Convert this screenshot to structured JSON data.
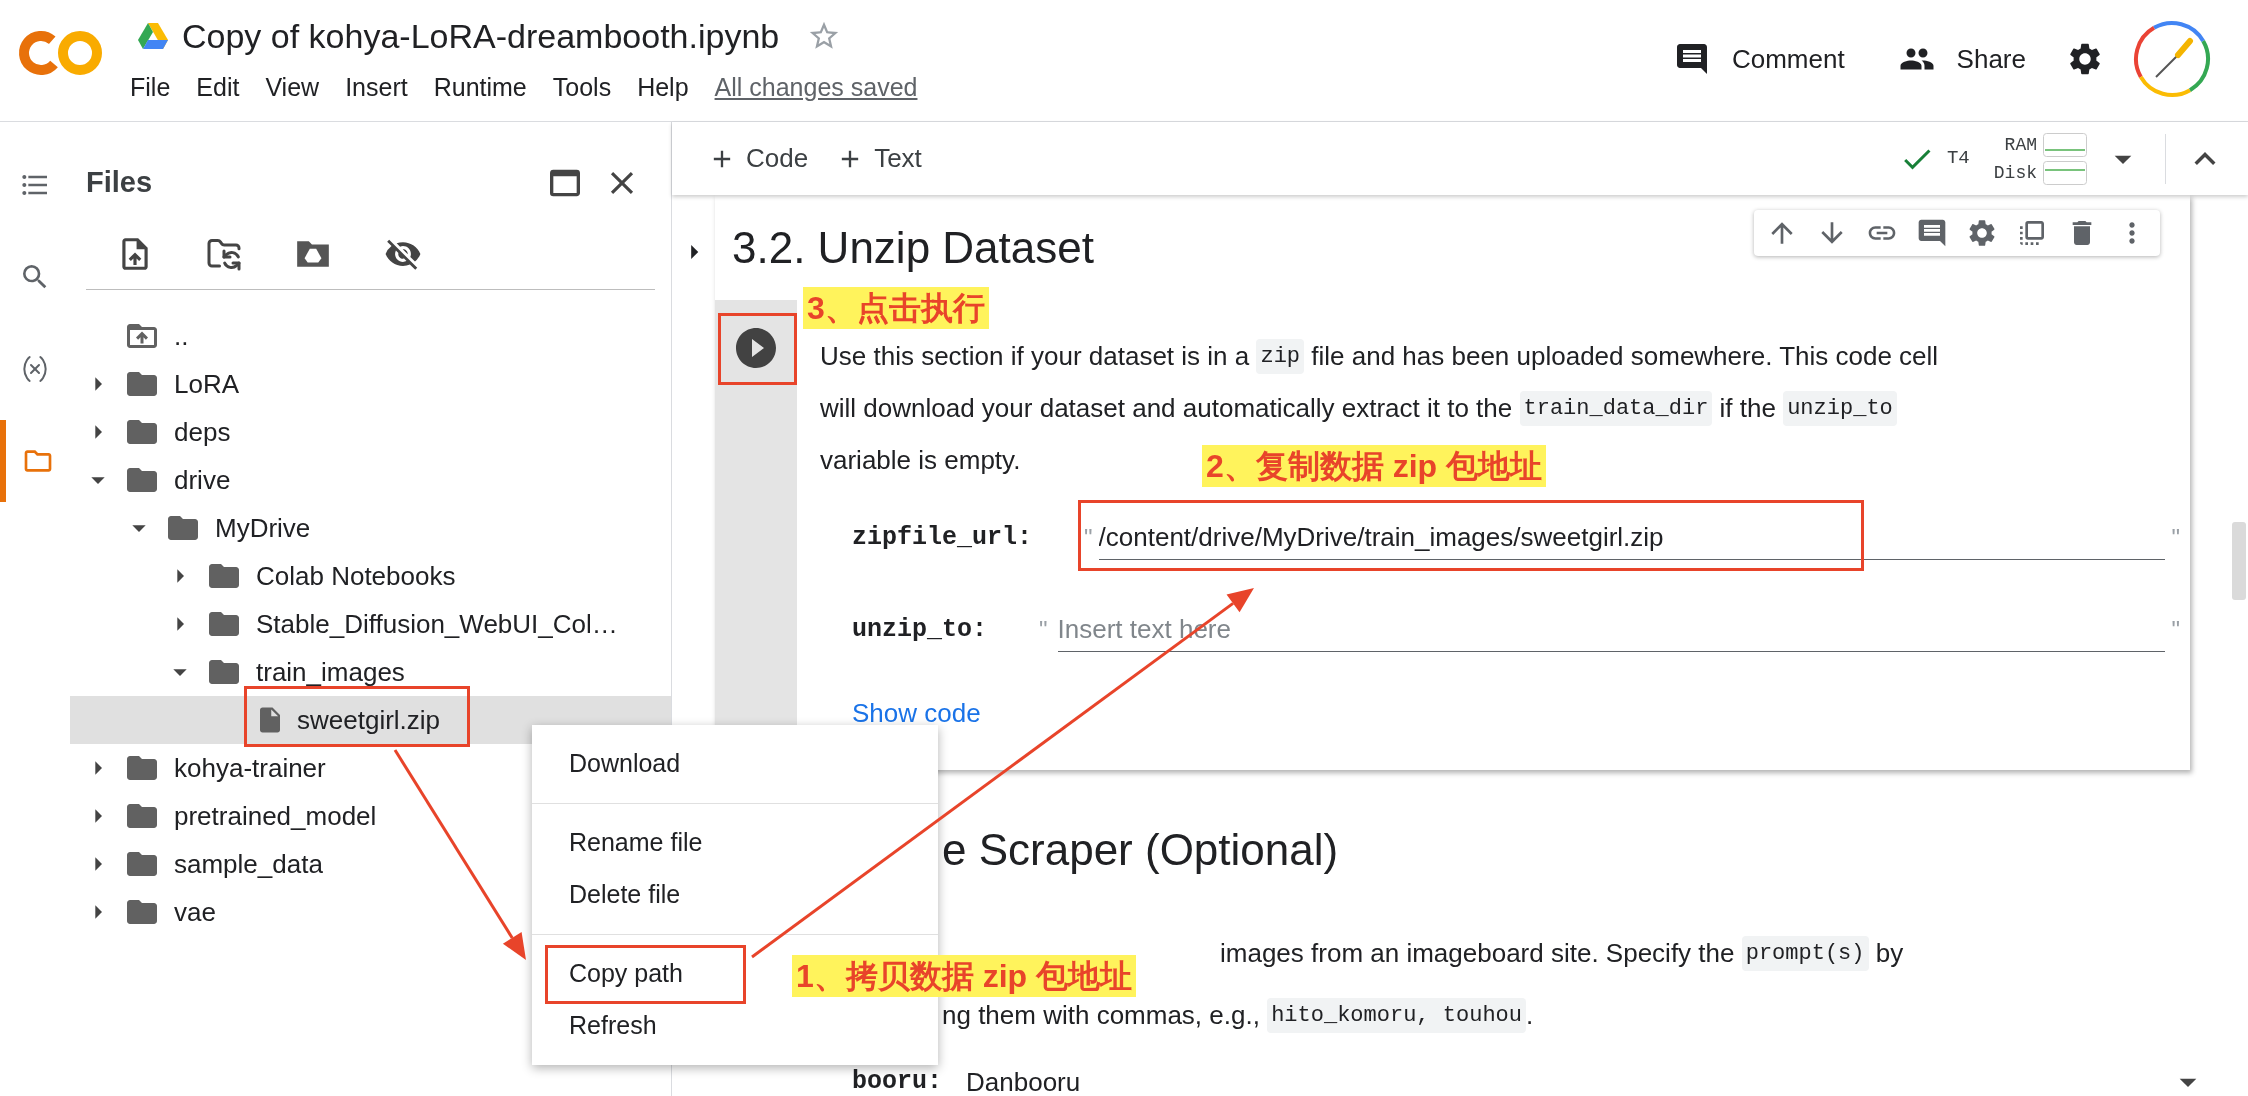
{
  "header": {
    "title": "Copy of kohya-LoRA-dreambooth.ipynb",
    "starred": false,
    "menu": [
      "File",
      "Edit",
      "View",
      "Insert",
      "Runtime",
      "Tools",
      "Help"
    ],
    "save_status": "All changes saved",
    "actions": [
      {
        "kind": "comment",
        "label": "Comment"
      },
      {
        "kind": "share",
        "label": "Share"
      }
    ]
  },
  "rail": [
    {
      "kind": "toc",
      "selected": false
    },
    {
      "kind": "search",
      "selected": false
    },
    {
      "kind": "variables",
      "selected": false
    },
    {
      "kind": "files",
      "selected": true
    }
  ],
  "files_panel": {
    "title": "Files",
    "tree": [
      {
        "name": "..",
        "kind": "parent",
        "selected": false
      },
      {
        "name": "LoRA",
        "kind": "folder",
        "expanded": false,
        "selected": false
      },
      {
        "name": "deps",
        "kind": "folder",
        "expanded": false,
        "selected": false
      },
      {
        "name": "drive",
        "kind": "folder",
        "expanded": true,
        "selected": false,
        "children": [
          {
            "name": "MyDrive",
            "kind": "folder",
            "expanded": true,
            "selected": false,
            "children": [
              {
                "name": "Colab Notebooks",
                "kind": "folder",
                "expanded": false,
                "selected": false
              },
              {
                "name": "Stable_Diffusion_WebUI_Col…",
                "kind": "folder",
                "expanded": false,
                "selected": false
              },
              {
                "name": "train_images",
                "kind": "folder",
                "expanded": true,
                "selected": false,
                "children": [
                  {
                    "name": "sweetgirl.zip",
                    "kind": "file",
                    "selected": true
                  }
                ]
              }
            ]
          }
        ]
      },
      {
        "name": "kohya-trainer",
        "kind": "folder",
        "expanded": false,
        "selected": false
      },
      {
        "name": "pretrained_model",
        "kind": "folder",
        "expanded": false,
        "selected": false
      },
      {
        "name": "sample_data",
        "kind": "folder",
        "expanded": false,
        "selected": false
      },
      {
        "name": "vae",
        "kind": "folder",
        "expanded": false,
        "selected": false
      }
    ]
  },
  "toolbar": {
    "add": [
      {
        "label": "Code"
      },
      {
        "label": "Text"
      }
    ],
    "runtime": {
      "connected": true,
      "name": "T4",
      "ram_label": "RAM",
      "disk_label": "Disk"
    }
  },
  "cell": {
    "heading": "3.2. Unzip Dataset",
    "lines": [
      [
        {
          "kind": "text",
          "text": "Use this section if your dataset is in a "
        },
        {
          "kind": "code",
          "text": "zip"
        },
        {
          "kind": "text",
          "text": " file and has been uploaded somewhere. This code cell"
        }
      ],
      [
        {
          "kind": "text",
          "text": "will download your dataset and automatically extract it to the "
        },
        {
          "kind": "code",
          "text": "train_data_dir"
        },
        {
          "kind": "text",
          "text": " if the "
        },
        {
          "kind": "code",
          "text": "unzip_to"
        }
      ],
      [
        {
          "kind": "text",
          "text": "variable is empty."
        }
      ]
    ],
    "fields": [
      {
        "label": "zipfile_url:",
        "open_quote": "\"",
        "value": "/content/drive/MyDrive/train_images/sweetgirl.zip",
        "close_quote": "\""
      },
      {
        "label": "unzip_to:",
        "open_quote": "\"",
        "placeholder": "Insert text here",
        "close_quote": "\""
      }
    ],
    "show_code": "Show code"
  },
  "context_menu": {
    "groups": [
      [
        {
          "label": "Download"
        }
      ],
      [
        {
          "label": "Rename file"
        },
        {
          "label": "Delete file"
        }
      ],
      [
        {
          "label": "Copy path"
        },
        {
          "label": "Refresh"
        }
      ]
    ]
  },
  "next_section": {
    "heading": "e Scraper (Optional)",
    "lines": [
      [
        {
          "kind": "text",
          "text": "images from an imageboard site. Specify the "
        },
        {
          "kind": "code",
          "text": "prompt(s)"
        },
        {
          "kind": "text",
          "text": " by"
        }
      ],
      [
        {
          "kind": "text",
          "text": "ng them with commas, e.g., "
        },
        {
          "kind": "code",
          "text": "hito_komoru, touhou"
        },
        {
          "kind": "text",
          "text": "."
        }
      ]
    ],
    "field": {
      "label": "booru:",
      "value": "Danbooru"
    }
  },
  "annotations": [
    {
      "text": "3、点击执行"
    },
    {
      "text": "2、复制数据 zip 包地址"
    },
    {
      "text": "1、拷贝数据 zip 包地址"
    }
  ]
}
